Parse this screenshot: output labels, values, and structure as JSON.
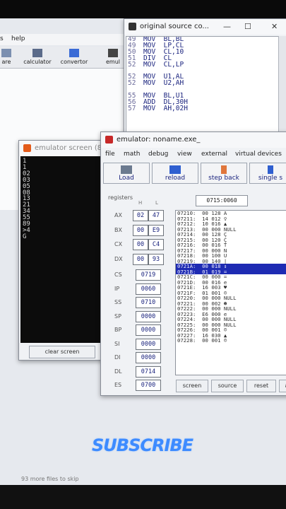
{
  "main_window": {
    "menu": [
      "s",
      "help"
    ],
    "toolbar": [
      {
        "label": "are",
        "icon": "save-icon"
      },
      {
        "label": "calculator",
        "icon": "calculator-icon"
      },
      {
        "label": "convertor",
        "icon": "convertor-icon"
      },
      {
        "label": "emul",
        "icon": "emulate-icon"
      }
    ]
  },
  "source_window": {
    "title": "original source co...",
    "lines": [
      {
        "n": "49",
        "code": "MOV  BL,BL"
      },
      {
        "n": "49",
        "code": "MOV  LP,CL"
      },
      {
        "n": "50",
        "code": "MOV  CL,10"
      },
      {
        "n": "51",
        "code": "DIV  CL"
      },
      {
        "n": "52",
        "code": "MOV  CL,LP"
      },
      {
        "n": "",
        "code": ""
      },
      {
        "n": "52",
        "code": "MOV  U1,AL"
      },
      {
        "n": "52",
        "code": "MOV  U2,AH"
      },
      {
        "n": "",
        "code": ""
      },
      {
        "n": "55",
        "code": "MOV  BL,U1"
      },
      {
        "n": "56",
        "code": "ADD  DL,30H"
      },
      {
        "n": "57",
        "code": "MOV  AH,02H"
      }
    ]
  },
  "screen_window": {
    "title": "emulator screen (80",
    "output": [
      "1",
      "1",
      "02",
      "03",
      "05",
      "08",
      "13",
      "21",
      "34",
      "55",
      "89",
      ">4",
      "G"
    ],
    "clear_label": "clear screen"
  },
  "emulator": {
    "title": "emulator: noname.exe_",
    "menu": [
      "file",
      "math",
      "debug",
      "view",
      "external",
      "virtual devices"
    ],
    "buttons": {
      "load": "Load",
      "reload": "reload",
      "step_back": "step back",
      "single_step": "single s"
    },
    "registers_label": "registers",
    "h_label": "H",
    "l_label": "L",
    "address": "0715:0060",
    "regs_hl": [
      {
        "name": "AX",
        "h": "02",
        "l": "47"
      },
      {
        "name": "BX",
        "h": "00",
        "l": "E9"
      },
      {
        "name": "CX",
        "h": "00",
        "l": "C4"
      },
      {
        "name": "DX",
        "h": "00",
        "l": "93"
      }
    ],
    "regs_single": [
      {
        "name": "CS",
        "value": "0719"
      },
      {
        "name": "IP",
        "value": "0060"
      },
      {
        "name": "SS",
        "value": "0710"
      },
      {
        "name": "SP",
        "value": "0000"
      },
      {
        "name": "BP",
        "value": "0000"
      },
      {
        "name": "SI",
        "value": "0000"
      },
      {
        "name": "DI",
        "value": "0000"
      },
      {
        "name": "DL",
        "value": "0714"
      },
      {
        "name": "ES",
        "value": "0700"
      }
    ],
    "memory": [
      "07210:  00 128 A",
      "07211:  14 012 ♀",
      "07212:  10 016 ▲",
      "07213:  00 000 NULL",
      "07214:  00 128 Ç",
      "07215:  00 120 Ç",
      "07216:  00 016 T",
      "07217:  00 000 N",
      "07218:  00 100 U",
      "07219:  00 140 |",
      "0721A:  00 018 ↕",
      "0721B:  01 019 =",
      "0721C:  00 000 =",
      "0721D:  00 016 e",
      "0721E:  16 003 ♥",
      "0721F:  01 001 ☺",
      "07220:  00 000 NULL",
      "07221:  00 002 ☻",
      "07222:  00 000 NULL",
      "07223:  E6 000 e",
      "07224:  00 000 NULL",
      "07225:  00 000 NULL",
      "07226:  00 001 ☺",
      "07227:  16 030 ▲",
      "07228:  00 001 ☺"
    ],
    "selected_rows": [
      10,
      11
    ],
    "bottom": [
      "screen",
      "source",
      "reset",
      "a"
    ]
  },
  "overlay": {
    "subscribe": "SUBSCRIBE"
  },
  "status_text": "93 more files to skip"
}
